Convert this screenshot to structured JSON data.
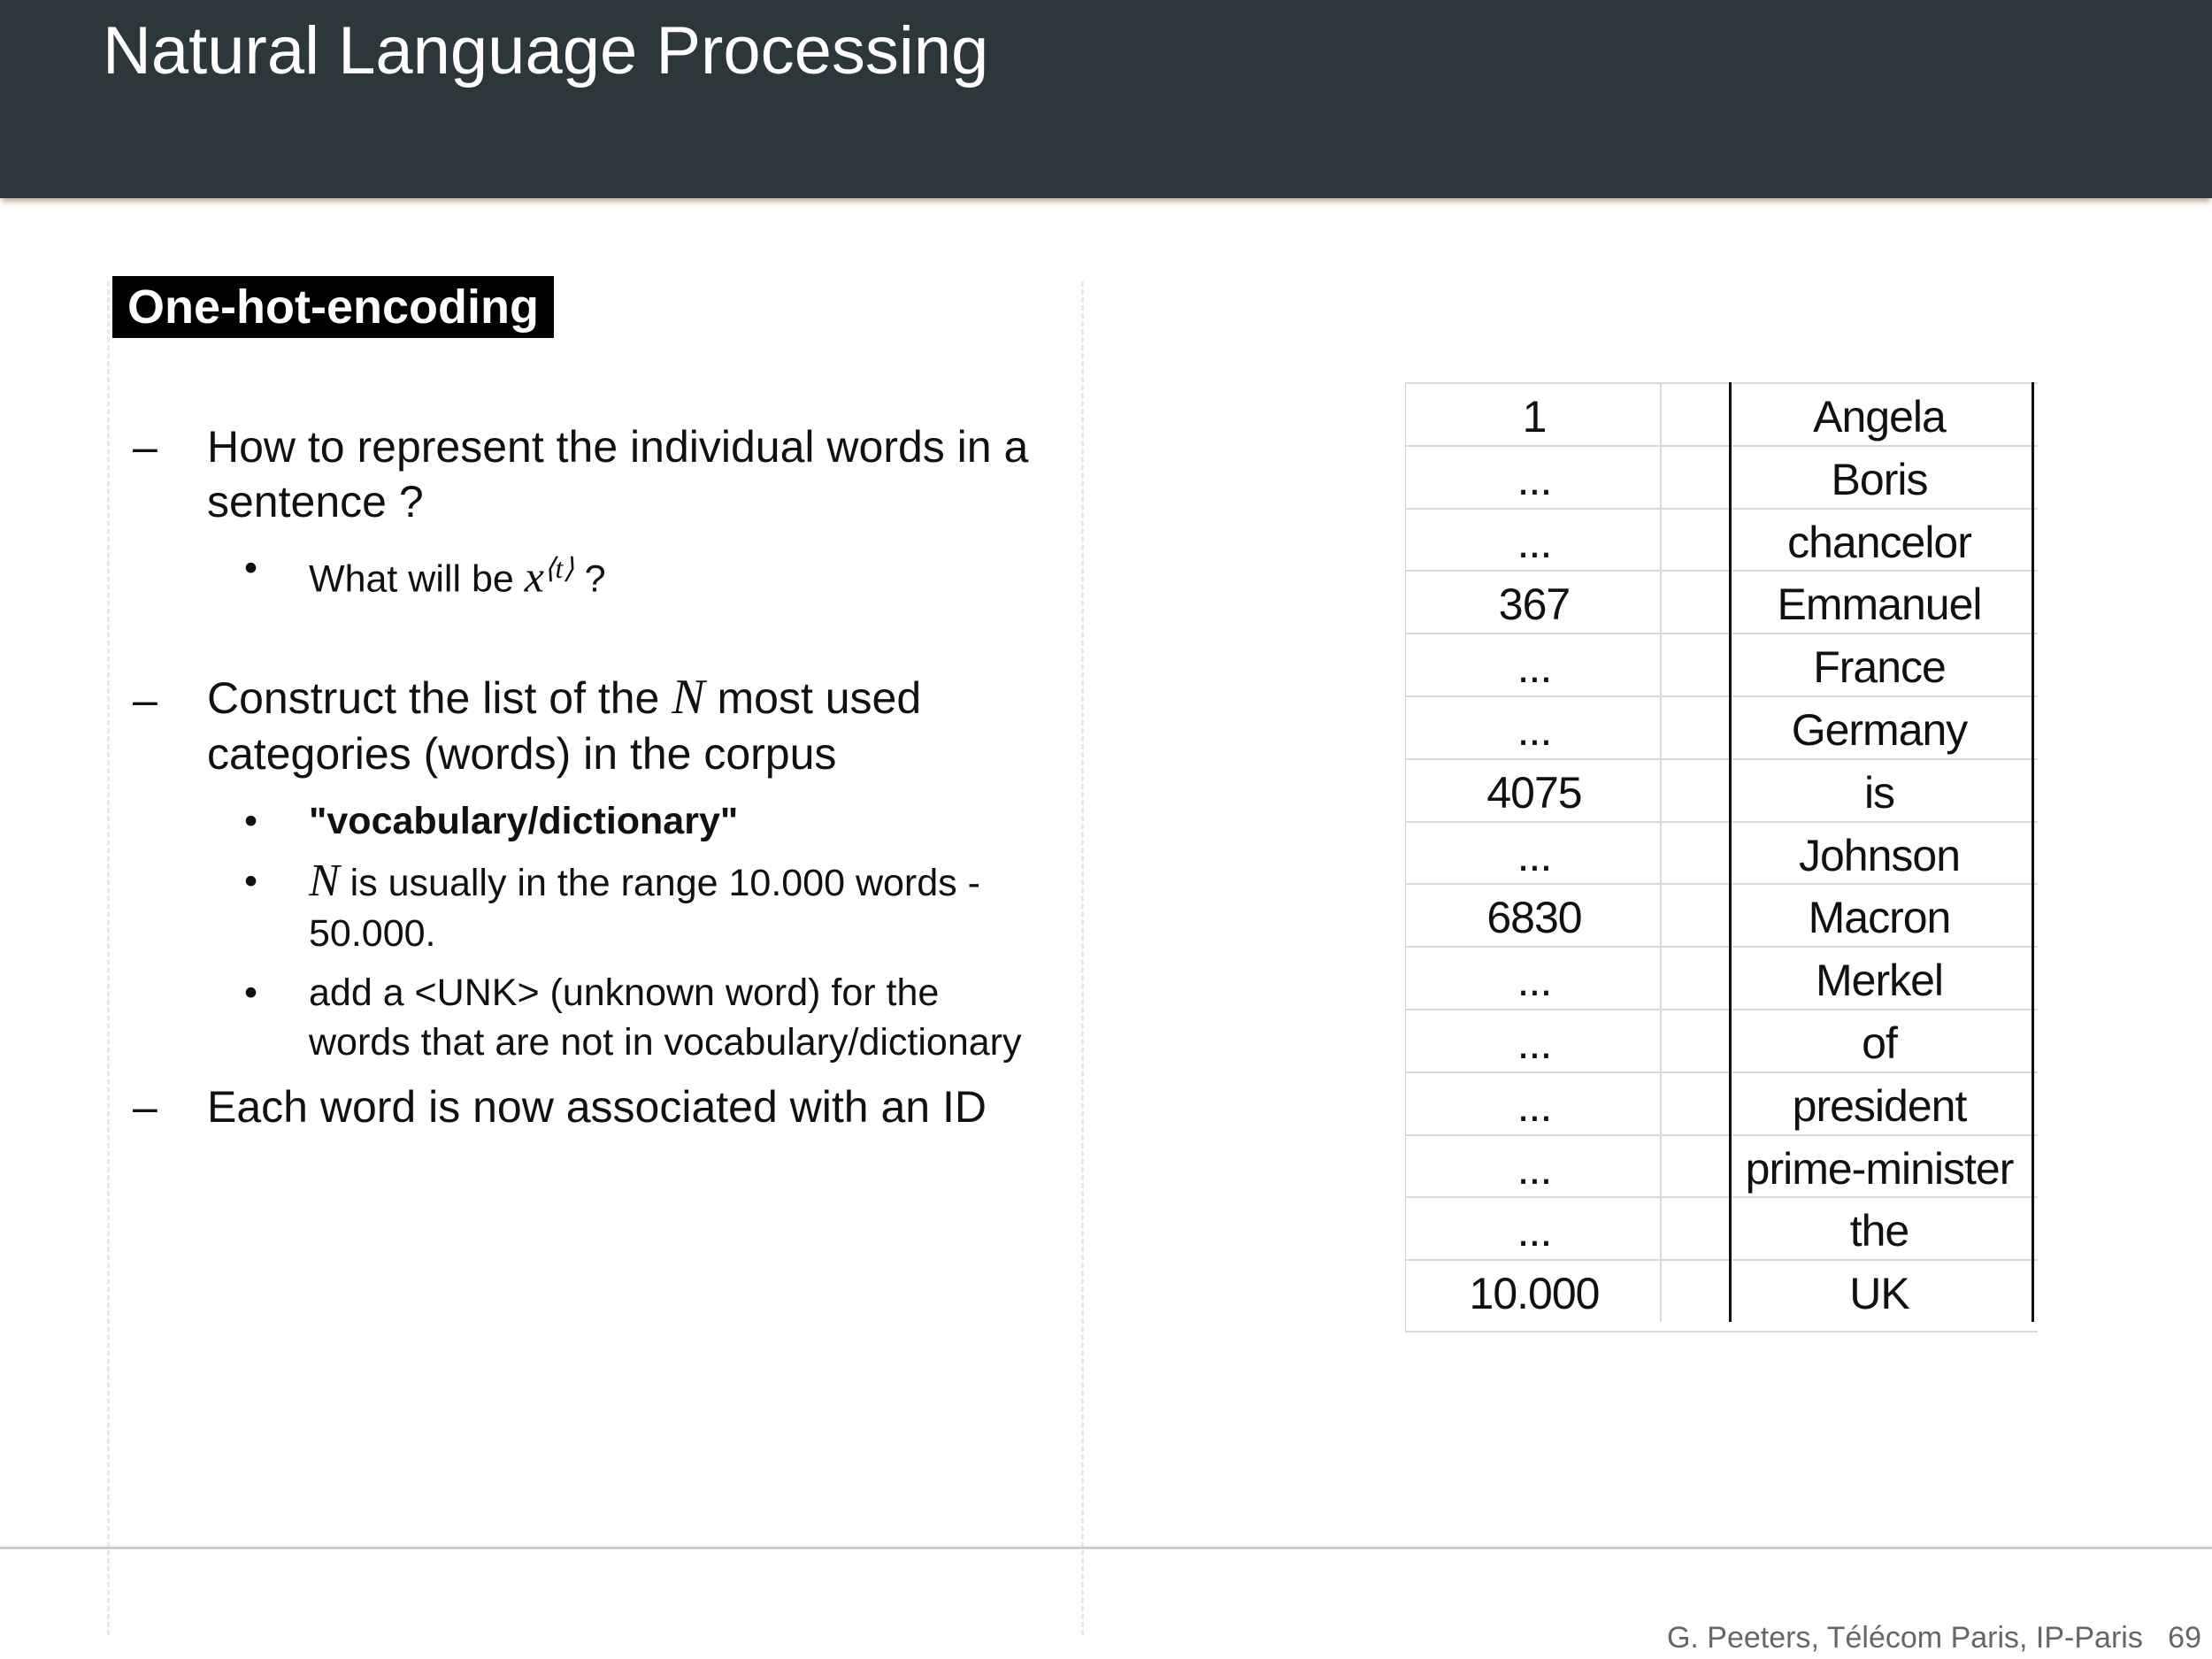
{
  "header": {
    "title": "Natural Language Processing"
  },
  "section": {
    "title": "One-hot-encoding"
  },
  "bullets": {
    "b1": {
      "marker": "–",
      "line1": "How to represent the individual words in a",
      "line2": "sentence ?",
      "sub1": {
        "marker": "•",
        "pre": "What will be ",
        "math": "x",
        "sup": "⟨t⟩",
        "post": " ?"
      }
    },
    "b2": {
      "marker": "–",
      "line1_pre": "Construct the list of the ",
      "line1_math": "N",
      "line1_post": " most used",
      "line2": "categories (words) in the corpus",
      "sub1": {
        "marker": "•",
        "text": "\"vocabulary/dictionary\""
      },
      "sub2": {
        "marker": "•",
        "math": "N",
        "line1": " is usually in the range 10.000 words -",
        "line2": "50.000."
      },
      "sub3": {
        "marker": "•",
        "line1": "add a <UNK> (unknown word) for the",
        "line2": "words that are not in vocabulary/dictionary"
      }
    },
    "b3": {
      "marker": "–",
      "text": "Each word is now associated with an ID"
    }
  },
  "table": {
    "rows": [
      {
        "id": "1",
        "word": "Angela"
      },
      {
        "id": "...",
        "word": "Boris"
      },
      {
        "id": "...",
        "word": "chancelor"
      },
      {
        "id": "367",
        "word": "Emmanuel"
      },
      {
        "id": "...",
        "word": "France"
      },
      {
        "id": "...",
        "word": "Germany"
      },
      {
        "id": "4075",
        "word": "is"
      },
      {
        "id": "...",
        "word": "Johnson"
      },
      {
        "id": "6830",
        "word": "Macron"
      },
      {
        "id": "...",
        "word": "Merkel"
      },
      {
        "id": "...",
        "word": "of"
      },
      {
        "id": "...",
        "word": "president"
      },
      {
        "id": "...",
        "word": "prime-minister"
      },
      {
        "id": "...",
        "word": "the"
      },
      {
        "id": "10.000",
        "word": "UK"
      }
    ]
  },
  "footer": {
    "author": "G. Peeters, Télécom Paris, IP-Paris",
    "page": "69"
  }
}
